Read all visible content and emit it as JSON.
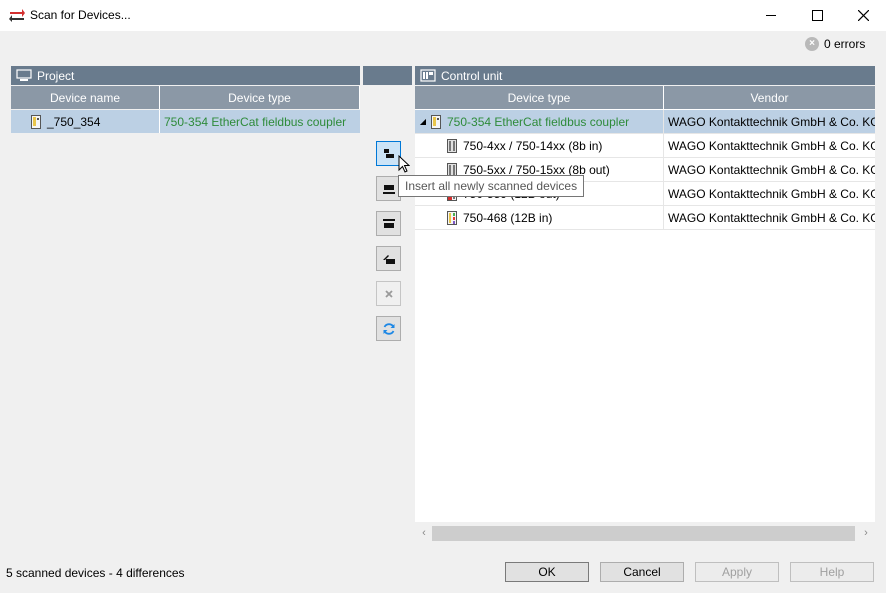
{
  "window": {
    "title": "Scan for Devices...",
    "buttons": {
      "minimize": "—",
      "maximize": "☐",
      "close": "✕"
    }
  },
  "errors": {
    "icon": "error-circle-icon",
    "count_label": "0 errors"
  },
  "project": {
    "header": "Project",
    "columns": [
      "Device name",
      "Device type"
    ],
    "rows": [
      {
        "name": "_750_354",
        "type": "750-354 EtherCat fieldbus coupler"
      }
    ]
  },
  "control_unit": {
    "header": "Control unit",
    "columns": [
      "Device type",
      "Vendor"
    ],
    "rows": [
      {
        "type": "750-354 EtherCat fieldbus coupler",
        "vendor": "WAGO Kontakttechnik GmbH & Co. KG"
      },
      {
        "type": "750-4xx / 750-14xx (8b in)",
        "vendor": "WAGO Kontakttechnik GmbH & Co. KG"
      },
      {
        "type": "750-5xx / 750-15xx (8b out)",
        "vendor": "WAGO Kontakttechnik GmbH & Co. KG"
      },
      {
        "type": "750-559 (12B out)",
        "vendor": "WAGO Kontakttechnik GmbH & Co. KG"
      },
      {
        "type": "750-468 (12B in)",
        "vendor": "WAGO Kontakttechnik GmbH & Co. KG"
      }
    ]
  },
  "middle_buttons": {
    "tooltip": "Insert all newly scanned devices",
    "icons": [
      "insert-all-icon",
      "insert-device-icon",
      "replace-device-icon",
      "copy-device-icon",
      "delete-icon",
      "refresh-icon"
    ]
  },
  "footer": {
    "status": "5 scanned devices - 4 differences",
    "ok": "OK",
    "cancel": "Cancel",
    "apply": "Apply",
    "help": "Help"
  },
  "colors": {
    "panel_header": "#697b8d",
    "column_header": "#8b98a6",
    "selection": "#bcd0e4",
    "device_green": "#2e8b3a"
  }
}
